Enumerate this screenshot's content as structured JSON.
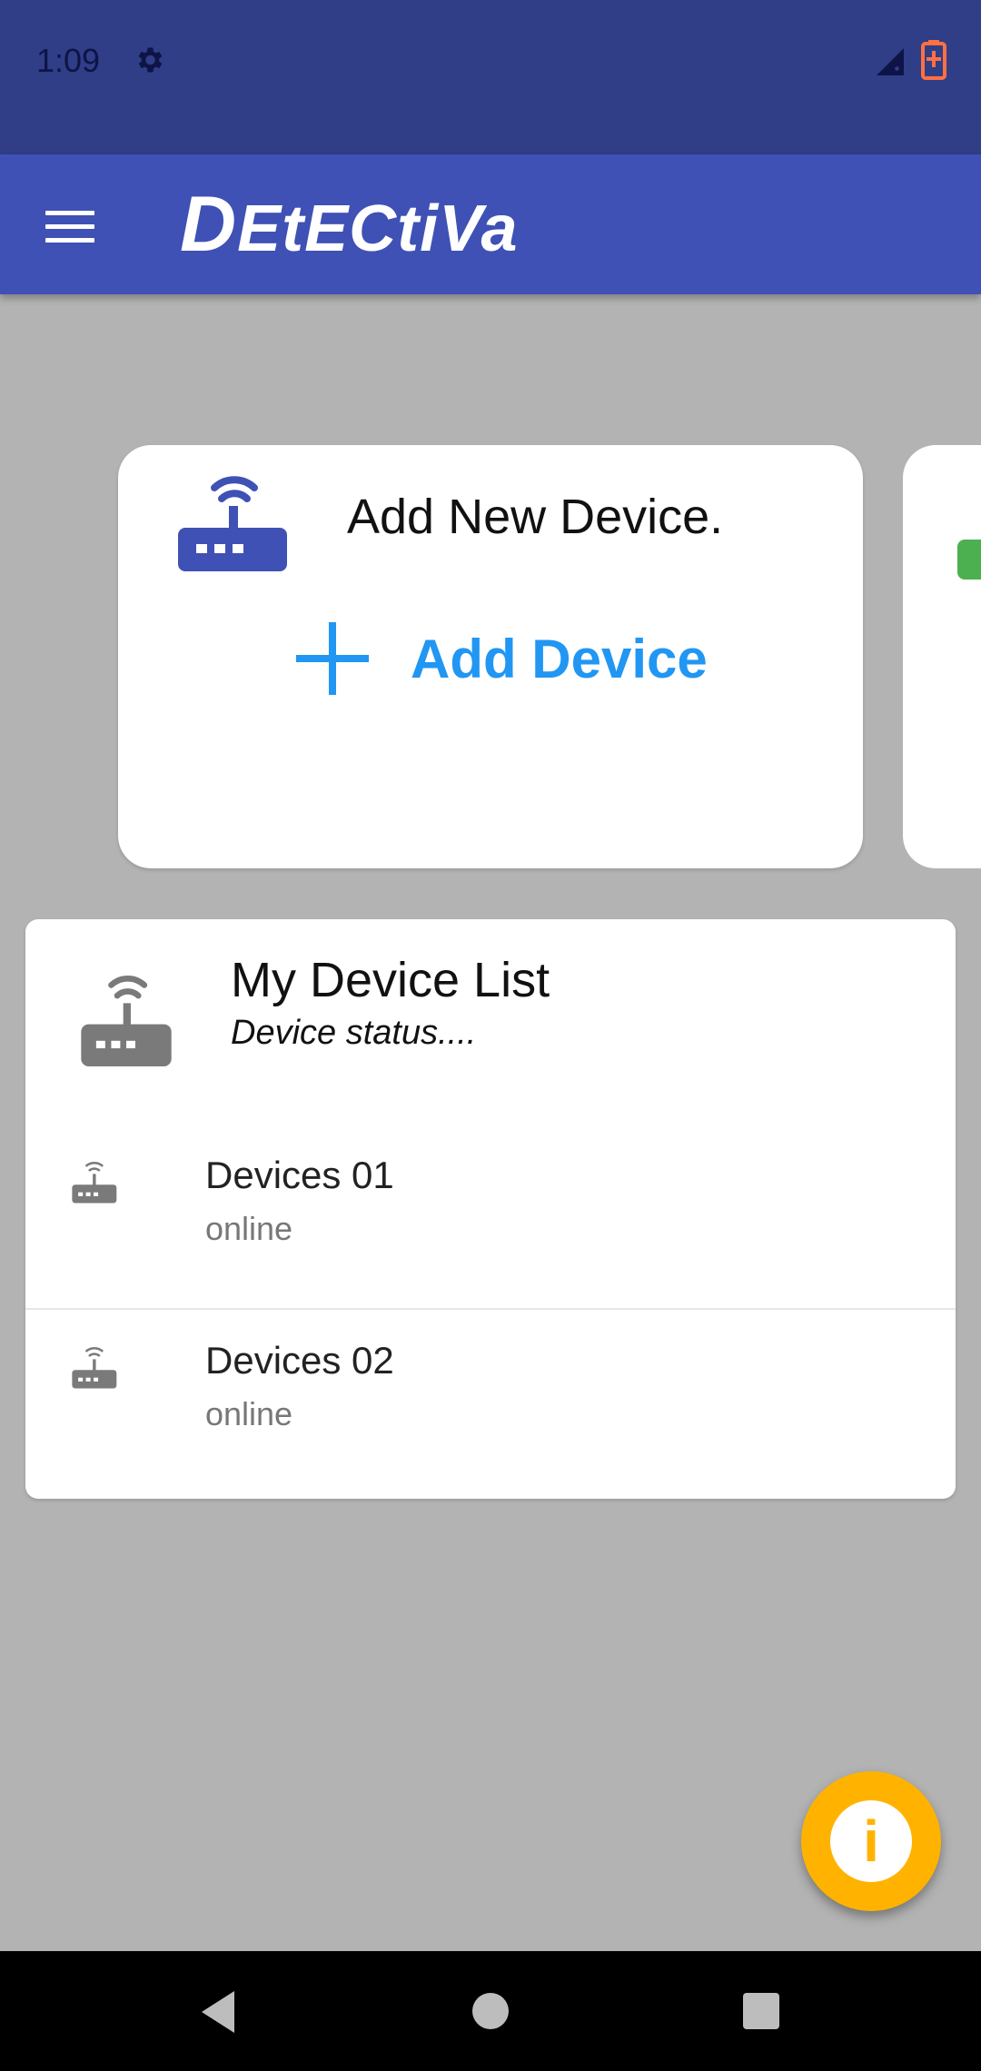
{
  "status_bar": {
    "time": "1:09"
  },
  "app_bar": {
    "logo_first": "D",
    "logo_rest": "EtECtiVa"
  },
  "add_card": {
    "title": "Add New Device.",
    "button_label": "Add Device"
  },
  "device_list": {
    "title": "My Device List",
    "subtitle": "Device status....",
    "items": [
      {
        "name": "Devices 01",
        "status": "online"
      },
      {
        "name": "Devices 02",
        "status": "online"
      }
    ]
  },
  "fab": {
    "label": "i"
  },
  "colors": {
    "status_bar": "#2f3e86",
    "app_bar": "#3f51b5",
    "accent_blue": "#2196f3",
    "fab": "#ffb300",
    "router_blue": "#3f51b5",
    "router_gray": "#7a7a7a"
  }
}
